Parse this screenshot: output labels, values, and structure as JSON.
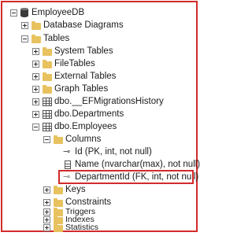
{
  "tree": {
    "database": "EmployeeDB",
    "items": {
      "database_diagrams": "Database Diagrams",
      "tables": "Tables",
      "system_tables": "System Tables",
      "file_tables": "FileTables",
      "external_tables": "External Tables",
      "graph_tables": "Graph Tables",
      "ef_migrations": "dbo.__EFMigrationsHistory",
      "departments": "dbo.Departments",
      "employees": "dbo.Employees",
      "columns": "Columns",
      "col_id": "Id (PK, int, not null)",
      "col_name": "Name (nvarchar(max), not null)",
      "col_departmentid": "DepartmentId (FK, int, not null)",
      "keys": "Keys",
      "constraints": "Constraints",
      "triggers": "Triggers",
      "indexes": "Indexes",
      "statistics": "Statistics"
    }
  },
  "icons": {
    "database": "database-icon",
    "folder": "folder-icon",
    "table": "table-icon",
    "primary_key": "primary-key-icon",
    "column": "column-icon",
    "foreign_key": "foreign-key-icon"
  },
  "colors": {
    "highlight_border": "#d32a2a",
    "folder": "#e8c25f"
  }
}
